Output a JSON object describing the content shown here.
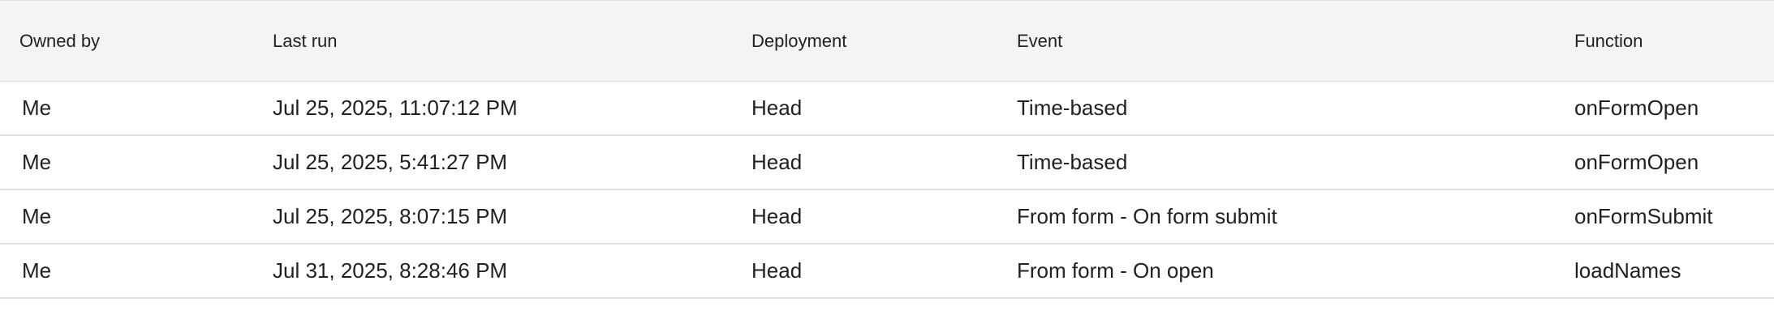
{
  "table": {
    "headers": {
      "owned_by": "Owned by",
      "last_run": "Last run",
      "deployment": "Deployment",
      "event": "Event",
      "function": "Function"
    },
    "rows": [
      {
        "owned_by": "Me",
        "last_run": "Jul 25, 2025, 11:07:12 PM",
        "deployment": "Head",
        "event": "Time-based",
        "function": "onFormOpen"
      },
      {
        "owned_by": "Me",
        "last_run": "Jul 25, 2025, 5:41:27 PM",
        "deployment": "Head",
        "event": "Time-based",
        "function": "onFormOpen"
      },
      {
        "owned_by": "Me",
        "last_run": "Jul 25, 2025, 8:07:15 PM",
        "deployment": "Head",
        "event": "From form - On form submit",
        "function": "onFormSubmit"
      },
      {
        "owned_by": "Me",
        "last_run": "Jul 31, 2025, 8:28:46 PM",
        "deployment": "Head",
        "event": "From form - On open",
        "function": "loadNames"
      }
    ]
  }
}
